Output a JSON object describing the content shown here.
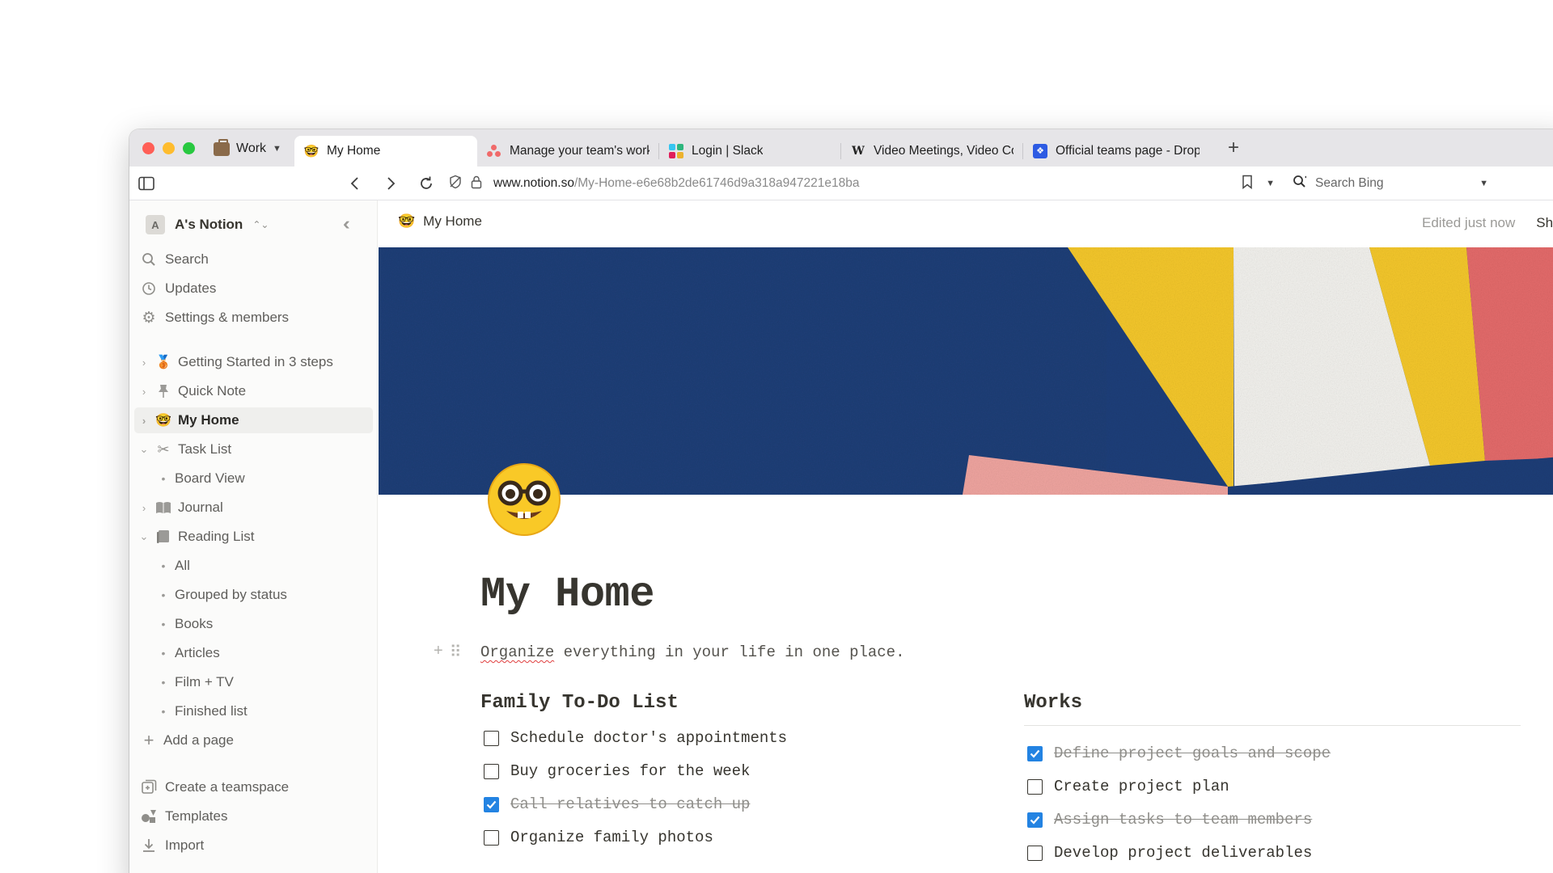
{
  "browser": {
    "container": {
      "label": "Work"
    },
    "tabs": [
      {
        "title": "My Home",
        "favicon": "nerd-face-emoji",
        "active": true
      },
      {
        "title": "Manage your team's work,",
        "favicon": "asana-logo",
        "active": false
      },
      {
        "title": "Login | Slack",
        "favicon": "slack-logo",
        "active": false
      },
      {
        "title": "Video Meetings, Video Cor",
        "favicon": "whereby-logo",
        "active": false
      },
      {
        "title": "Official teams page - Drop",
        "favicon": "dropbox-logo",
        "active": false
      }
    ],
    "url": {
      "host": "www.notion.so",
      "path": "/My-Home-e6e68b2de61746d9a318a947221e18ba"
    },
    "search": {
      "placeholder": "Search Bing"
    }
  },
  "sidebar": {
    "workspace": {
      "initial": "A",
      "name": "A's Notion"
    },
    "top_items": [
      {
        "label": "Search",
        "icon": "search-icon"
      },
      {
        "label": "Updates",
        "icon": "clock-icon"
      },
      {
        "label": "Settings & members",
        "icon": "gear-icon"
      }
    ],
    "pages": [
      {
        "label": "Getting Started in 3 steps",
        "icon": "medal-emoji",
        "expanded": false
      },
      {
        "label": "Quick Note",
        "icon": "pushpin-icon",
        "expanded": false
      },
      {
        "label": "My Home",
        "icon": "nerd-face-emoji",
        "expanded": false,
        "active": true
      },
      {
        "label": "Task List",
        "icon": "scissors-icon",
        "expanded": true,
        "children": [
          "Board View"
        ]
      },
      {
        "label": "Journal",
        "icon": "book-icon",
        "expanded": false
      },
      {
        "label": "Reading List",
        "icon": "books-icon",
        "expanded": true,
        "children": [
          "All",
          "Grouped by status",
          "Books",
          "Articles",
          "Film + TV",
          "Finished list"
        ]
      }
    ],
    "add_page": "Add a page",
    "bottom_items": [
      {
        "label": "Create a teamspace",
        "icon": "teamspace-icon"
      },
      {
        "label": "Templates",
        "icon": "shapes-icon"
      },
      {
        "label": "Import",
        "icon": "download-icon"
      }
    ]
  },
  "topbar": {
    "breadcrumb": "My Home",
    "edited": "Edited just now",
    "share": "Share"
  },
  "page": {
    "title": "My Home",
    "subtitle_word": "Organize",
    "subtitle_rest": " everything in your life in one place.",
    "columns": [
      {
        "title": "Family To-Do List",
        "todos": [
          {
            "text": "Schedule doctor's appointments",
            "checked": false
          },
          {
            "text": "Buy groceries for the week",
            "checked": false
          },
          {
            "text": "Call relatives to catch up",
            "checked": true
          },
          {
            "text": "Organize family photos",
            "checked": false
          }
        ]
      },
      {
        "title": "Works",
        "todos": [
          {
            "text": "Define project goals and scope",
            "checked": true
          },
          {
            "text": "Create project plan",
            "checked": false
          },
          {
            "text": "Assign tasks to team members",
            "checked": true
          },
          {
            "text": "Develop project deliverables",
            "checked": false
          }
        ]
      }
    ]
  },
  "colors": {
    "accent": "#2383e2",
    "cover_navy": "#1e3f7a",
    "cover_yellow": "#f5c82b",
    "cover_pink": "#f0a5a0",
    "cover_red": "#e56b6b"
  }
}
